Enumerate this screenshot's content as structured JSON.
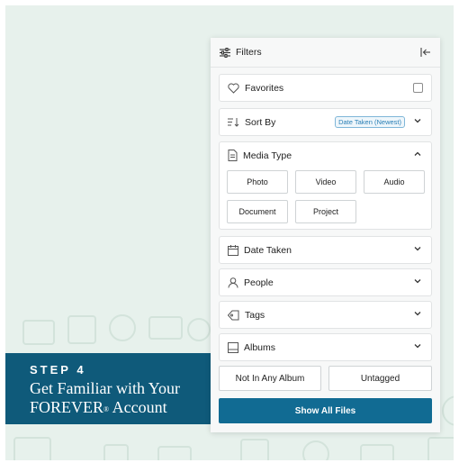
{
  "panel": {
    "title": "Filters",
    "favorites_label": "Favorites",
    "sort_label": "Sort By",
    "sort_value": "Date Taken (Newest)",
    "media_label": "Media Type",
    "media_options": [
      "Photo",
      "Video",
      "Audio",
      "Document",
      "Project"
    ],
    "date_label": "Date Taken",
    "people_label": "People",
    "tags_label": "Tags",
    "albums_label": "Albums",
    "not_in_album_label": "Not In Any Album",
    "untagged_label": "Untagged",
    "show_all_label": "Show All Files"
  },
  "banner": {
    "step": "STEP 4",
    "title_line1": "Get Familiar with Your",
    "title_line2": "FOREVER",
    "title_line2_mark": "®",
    "title_line2_end": " Account"
  },
  "colors": {
    "background": "#e7f1ec",
    "banner": "#0f5a7a",
    "primary_button": "#116b93",
    "badge_text": "#2a7fb5"
  },
  "icons": {
    "filters": "sliders-icon",
    "collapse": "collapse-left-icon",
    "favorites": "heart-icon",
    "sort": "sort-icon",
    "media": "document-icon",
    "date": "calendar-icon",
    "people": "person-icon",
    "tags": "tag-icon",
    "albums": "album-icon"
  }
}
